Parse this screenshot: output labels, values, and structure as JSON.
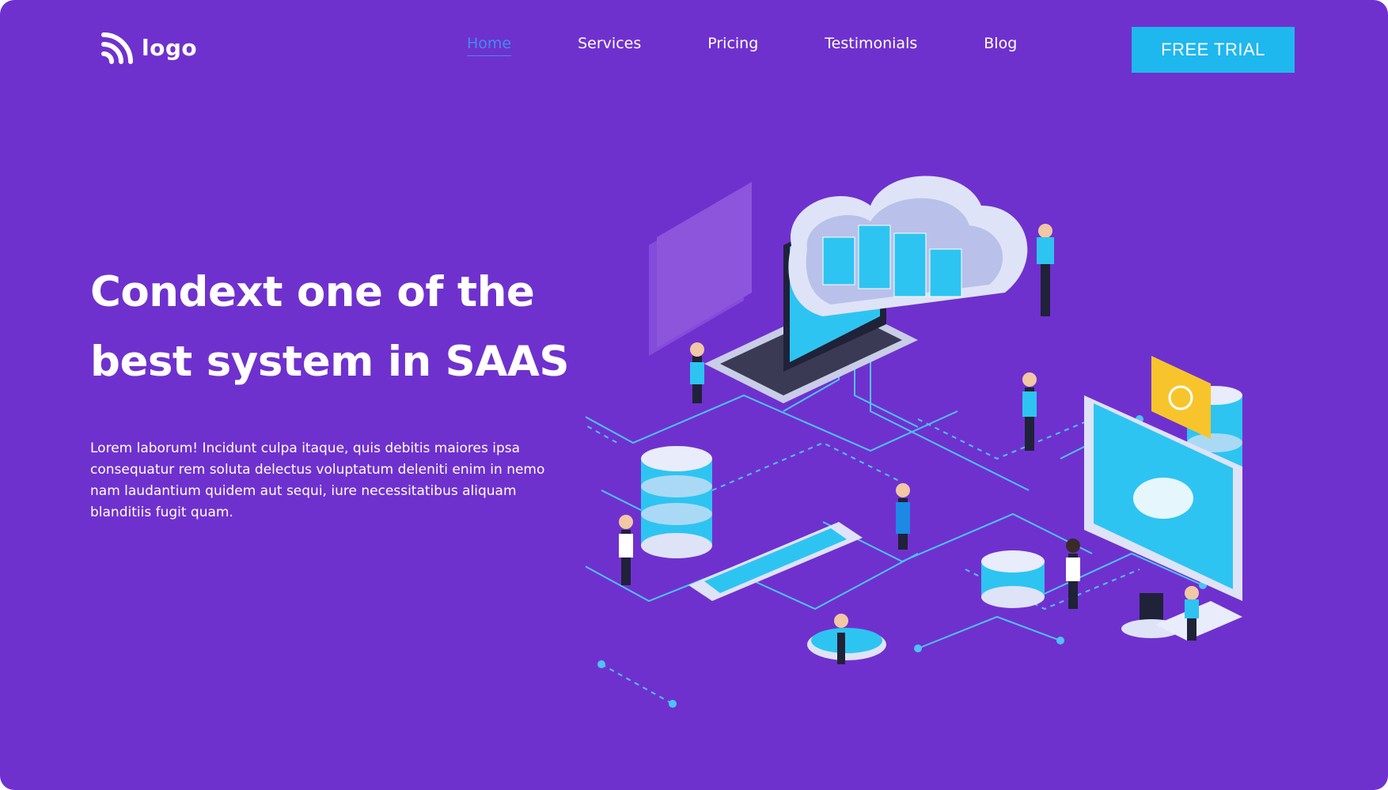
{
  "brand": {
    "logo_text": "logo",
    "logo_icon": "wifi-signal-icon"
  },
  "nav": {
    "items": [
      {
        "label": "Home",
        "active": true
      },
      {
        "label": "Services",
        "active": false
      },
      {
        "label": "Pricing",
        "active": false
      },
      {
        "label": "Testimonials",
        "active": false
      },
      {
        "label": "Blog",
        "active": false
      }
    ]
  },
  "cta": {
    "label": "FREE TRIAL"
  },
  "hero": {
    "title_line1": "Condext one of the",
    "title_line2": "best system in SAAS",
    "body": "Lorem laborum! Incidunt culpa itaque, quis debitis maiores ipsa consequatur rem soluta delectus voluptatum deleniti enim in nemo nam laudantium quidem aut sequi, iure necessitatibus aliquam blanditiis fugit quam."
  },
  "colors": {
    "background": "#6f31ce",
    "accent": "#1eb7ee",
    "nav_active": "#3f8bf3",
    "text": "#ffffff"
  }
}
